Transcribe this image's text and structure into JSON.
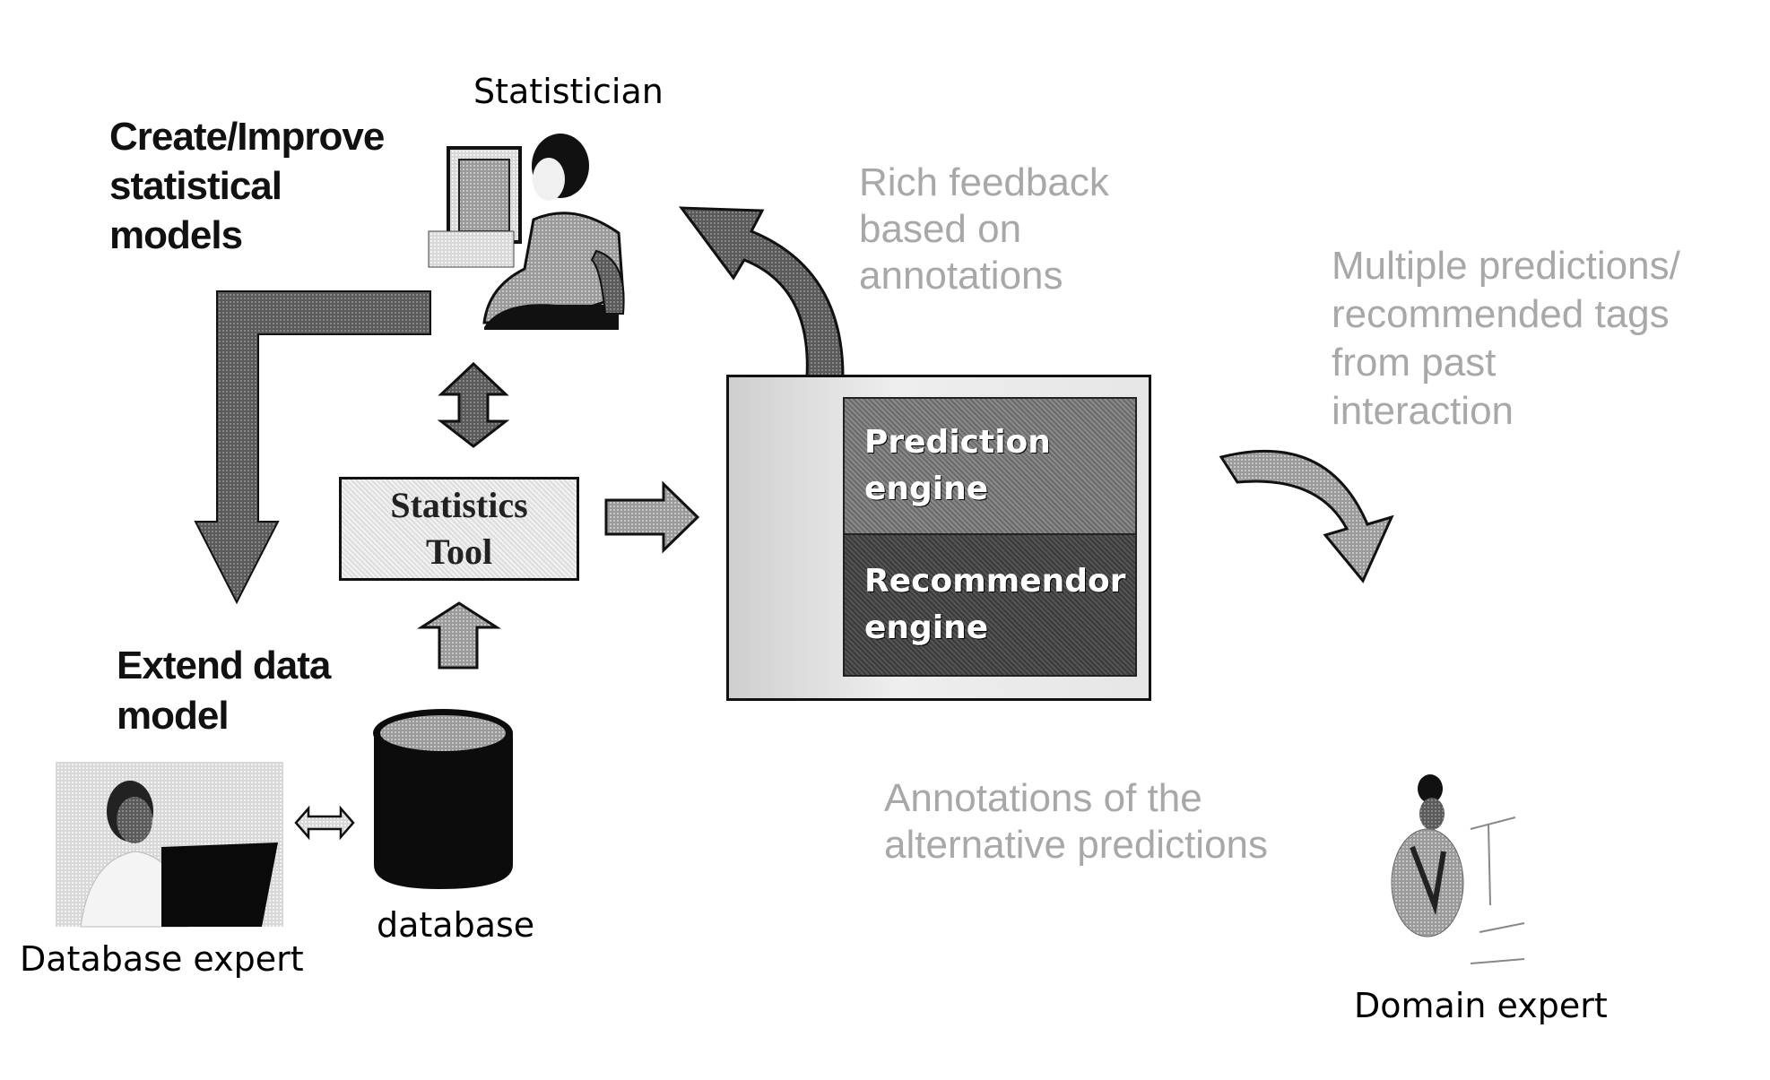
{
  "actors": {
    "statistician": "Statistician",
    "database_expert": "Database expert",
    "domain_expert": "Domain expert"
  },
  "labels": {
    "create_improve": [
      "Create/Improve",
      "statistical",
      "models"
    ],
    "extend_data_model": [
      "Extend data",
      "model"
    ],
    "database": "database",
    "rich_feedback": [
      "Rich feedback",
      "based on",
      "annotations"
    ],
    "multiple_predictions": [
      "Multiple predictions/",
      "recommended tags",
      "from past",
      "interaction"
    ],
    "annotations_alt": [
      "Annotations of the",
      "alternative predictions"
    ]
  },
  "statistics_tool": [
    "Statistics",
    "Tool"
  ],
  "engines": {
    "prediction": [
      "Prediction",
      "engine"
    ],
    "recommendor": [
      "Recommendor",
      "engine"
    ]
  }
}
